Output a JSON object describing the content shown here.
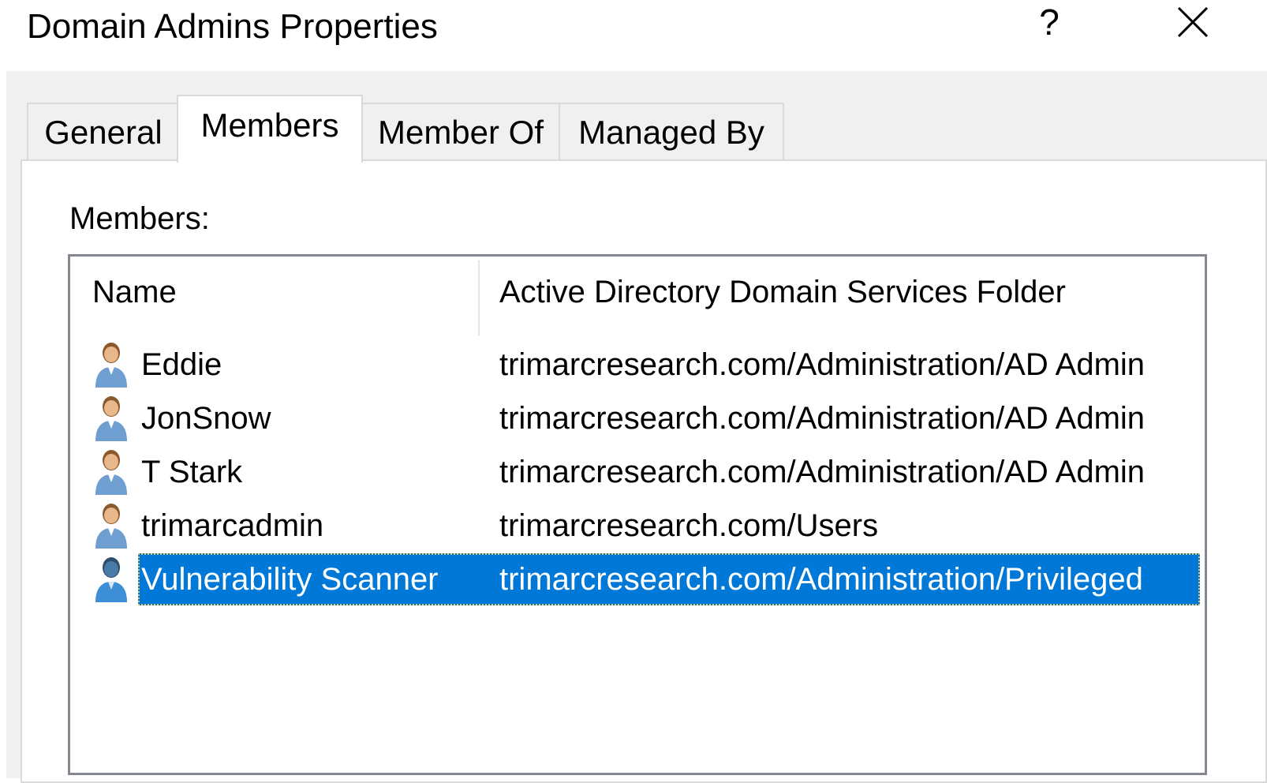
{
  "window": {
    "title": "Domain Admins Properties",
    "help_label": "?"
  },
  "tabs": [
    {
      "label": "General"
    },
    {
      "label": "Members"
    },
    {
      "label": "Member Of"
    },
    {
      "label": "Managed By"
    }
  ],
  "active_tab": "Members",
  "members_panel": {
    "label": "Members:",
    "columns": [
      "Name",
      "Active Directory Domain Services Folder"
    ],
    "rows": [
      {
        "name": "Eddie",
        "folder": "trimarcresearch.com/Administration/AD Admin",
        "icon": "user-icon"
      },
      {
        "name": "JonSnow",
        "folder": "trimarcresearch.com/Administration/AD Admin",
        "icon": "user-icon"
      },
      {
        "name": "T Stark",
        "folder": "trimarcresearch.com/Administration/AD Admin",
        "icon": "user-icon"
      },
      {
        "name": "trimarcadmin",
        "folder": "trimarcresearch.com/Users",
        "icon": "user-icon"
      },
      {
        "name": "Vulnerability Scanner",
        "folder": "trimarcresearch.com/Administration/Privileged",
        "icon": "user-icon"
      }
    ],
    "selected_row": "Vulnerability Scanner"
  },
  "colors": {
    "selection": "#0078d7",
    "dialog_bg": "#f0f0f0",
    "list_border": "#828790"
  }
}
